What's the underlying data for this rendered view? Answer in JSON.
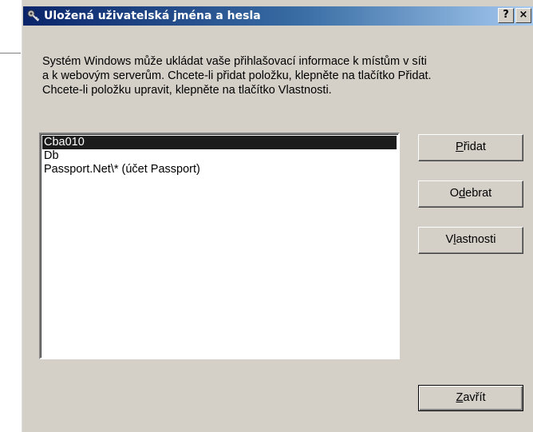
{
  "dialog": {
    "title": "Uložená uživatelská jména a hesla",
    "help_button": "?",
    "close_button": "×"
  },
  "description": {
    "lines": [
      "Systém Windows může ukládat vaše přihlašovací informace k místům v síti",
      "a k webovým serverům. Chcete-li přidat položku, klepněte na tlačítko Přidat.",
      "Chcete-li položku upravit, klepněte na tlačítko Vlastnosti."
    ]
  },
  "credentials_list": {
    "items": [
      {
        "label": "Cba010",
        "selected": true
      },
      {
        "label": "Db",
        "selected": false
      },
      {
        "label": "Passport.Net\\* (účet Passport)",
        "selected": false
      }
    ]
  },
  "buttons": {
    "add": {
      "before": "",
      "key": "P",
      "after": "řidat"
    },
    "remove": {
      "before": "O",
      "key": "d",
      "after": "ebrat"
    },
    "properties": {
      "before": "V",
      "key": "l",
      "after": "astnosti"
    },
    "close": {
      "before": "",
      "key": "Z",
      "after": "avřít"
    }
  },
  "icons": {
    "title_icon": "key-icon",
    "help_icon": "help-icon",
    "close_icon": "close-icon"
  },
  "colors": {
    "title_gradient_start": "#0a246a",
    "title_gradient_end": "#a6caf0",
    "dialog_face": "#d4d0c8",
    "selection": "#1c1c1c"
  }
}
